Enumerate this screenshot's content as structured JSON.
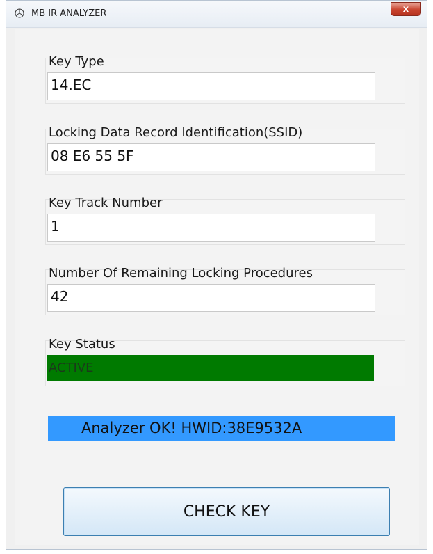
{
  "window": {
    "title": "MB IR ANALYZER",
    "close_label": "x"
  },
  "fields": {
    "key_type": {
      "label": "Key Type",
      "value": "14.EC"
    },
    "ssid": {
      "label": "Locking Data Record Identification(SSID)",
      "value": "08 E6 55 5F"
    },
    "track": {
      "label": "Key Track Number",
      "value": "1"
    },
    "remaining": {
      "label": "Number Of Remaining Locking  Procedures",
      "value": "42"
    },
    "status": {
      "label": "Key Status",
      "value": "ACTIVE",
      "color": "#007a00"
    }
  },
  "status_bar": {
    "text": "Analyzer OK!  HWID:38E9532A",
    "color": "#3399ff"
  },
  "check_button": {
    "label": "CHECK KEY"
  },
  "icons": {
    "app": "mercedes-star-icon",
    "close": "close-icon"
  }
}
